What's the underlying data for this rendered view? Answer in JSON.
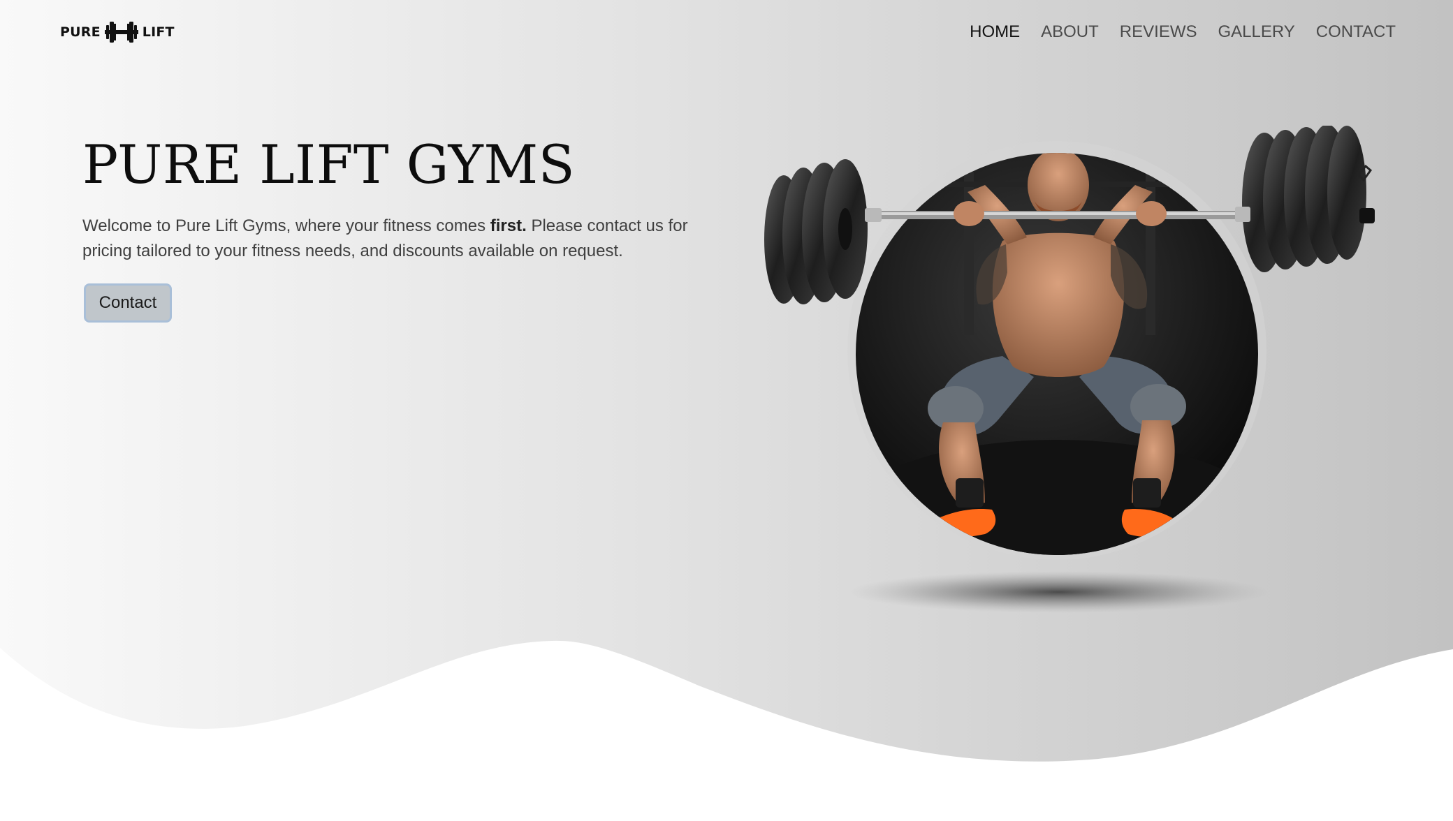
{
  "logo": {
    "left_word": "PURE",
    "right_word": "LIFT",
    "icon": "dumbbell-h-icon"
  },
  "nav": {
    "items": [
      {
        "label": "HOME",
        "active": true
      },
      {
        "label": "ABOUT",
        "active": false
      },
      {
        "label": "REVIEWS",
        "active": false
      },
      {
        "label": "GALLERY",
        "active": false
      },
      {
        "label": "CONTACT",
        "active": false
      }
    ]
  },
  "hero": {
    "title": "PURE LIFT GYMS",
    "text_before": "Welcome to Pure Lift Gyms, where your fitness comes ",
    "text_bold": "first.",
    "text_after": " Please contact us for pricing tailored to your fitness needs, and discounts available on request.",
    "button_label": "Contact",
    "image_icon": "weightlifter-squat-image"
  },
  "colors": {
    "background_light": "#f7f7f7",
    "background_dark": "#c8c8c8",
    "text_dark": "#0d0d0d",
    "text_muted": "#4a4a4a",
    "button_bg": "#c0c6cb",
    "button_border": "#a9bfd8",
    "shoe_accent": "#ff6a1a"
  }
}
